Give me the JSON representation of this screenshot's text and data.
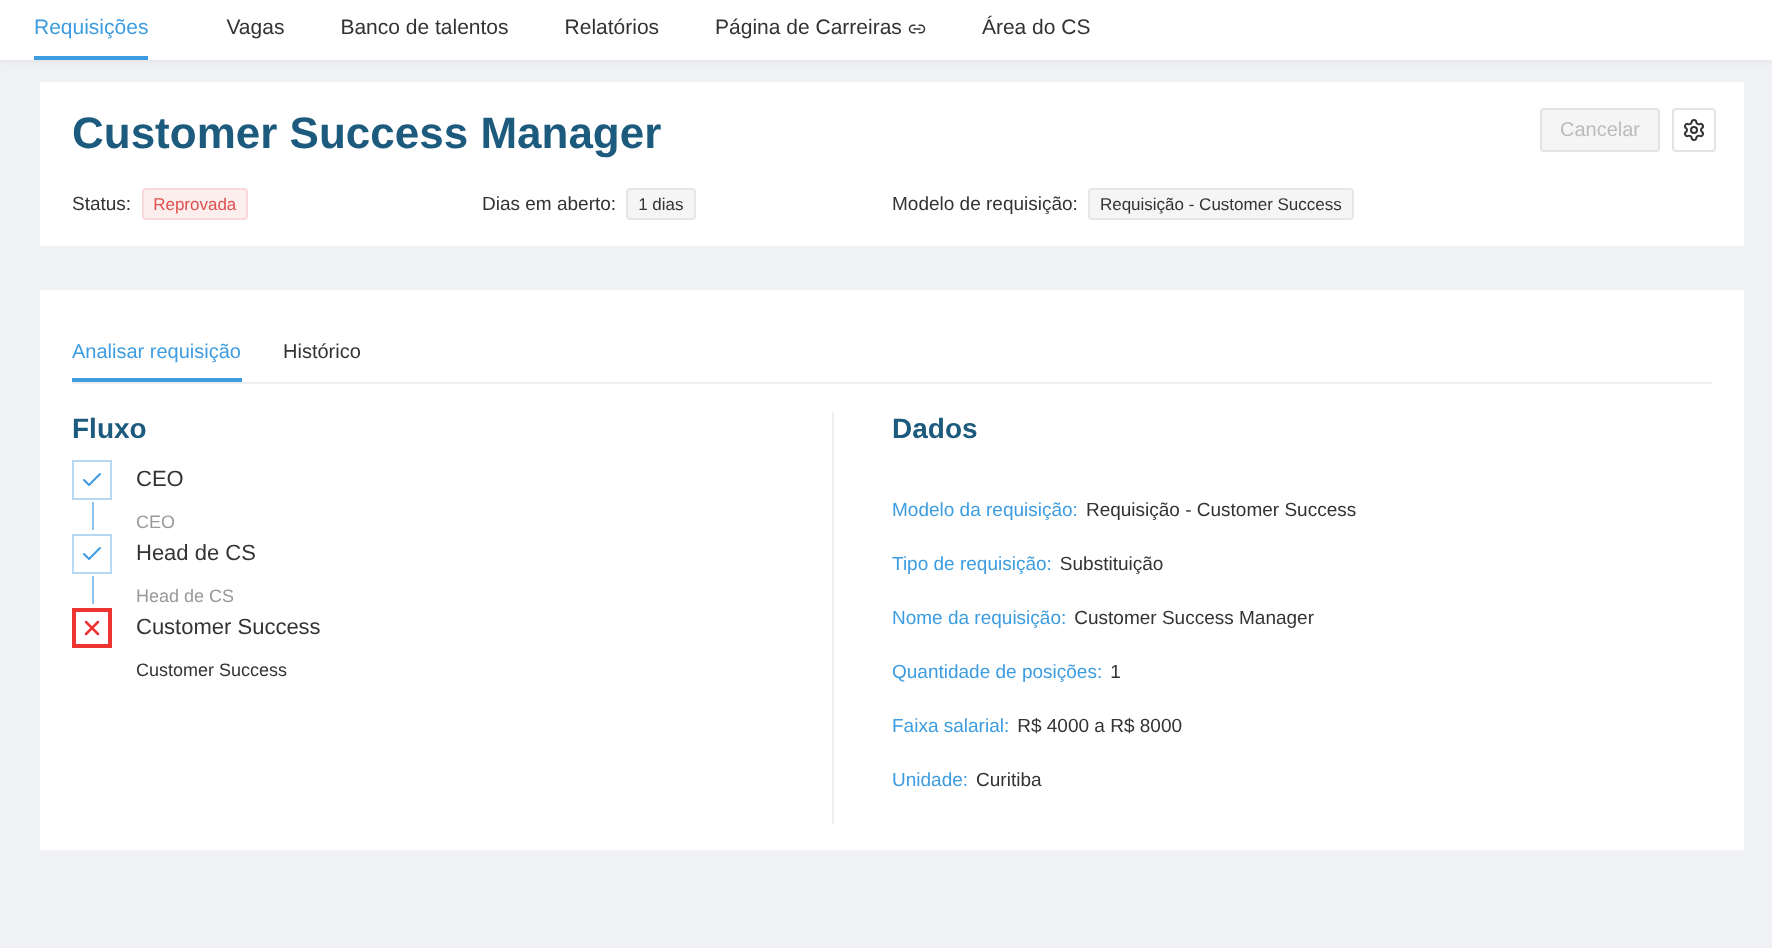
{
  "nav": [
    {
      "label": "Requisições",
      "selected": true,
      "external": false
    },
    {
      "label": "Vagas",
      "selected": false,
      "external": false
    },
    {
      "label": "Banco de talentos",
      "selected": false,
      "external": false
    },
    {
      "label": "Relatórios",
      "selected": false,
      "external": false
    },
    {
      "label": "Página de Carreiras",
      "selected": false,
      "external": true
    },
    {
      "label": "Área do CS",
      "selected": false,
      "external": false
    }
  ],
  "header": {
    "title": "Customer Success Manager",
    "cancel": {
      "label": "Cancelar",
      "disabled": true
    },
    "meta": [
      {
        "label": "Status:",
        "value": "Reprovada",
        "kind": "status"
      },
      {
        "label": "Dias em aberto:",
        "value": "1 dias",
        "kind": "tag"
      },
      {
        "label": "Modelo de requisição:",
        "value": "Requisição - Customer Success",
        "kind": "tag"
      }
    ]
  },
  "tabs": [
    {
      "label": "Analisar requisição",
      "selected": true
    },
    {
      "label": "Histórico",
      "selected": false
    }
  ],
  "flow": {
    "title": "Fluxo",
    "steps": [
      {
        "name": "CEO",
        "role": "CEO",
        "rejected": false
      },
      {
        "name": "Head de CS",
        "role": "Head de CS",
        "rejected": false
      },
      {
        "name": "Customer Success",
        "role": "Customer Success",
        "rejected": true
      }
    ]
  },
  "data": {
    "title": "Dados",
    "fields": [
      {
        "label": "Modelo da requisição:",
        "value": "Requisição - Customer Success"
      },
      {
        "label": "Tipo de requisição:",
        "value": "Substituição"
      },
      {
        "label": "Nome da requisição:",
        "value": "Customer Success Manager"
      },
      {
        "label": "Quantidade de posições:",
        "value": "1"
      },
      {
        "label": "Faixa salarial:",
        "value": "R$ 4000 a R$ 8000"
      },
      {
        "label": "Unidade:",
        "value": "Curitiba"
      }
    ]
  }
}
